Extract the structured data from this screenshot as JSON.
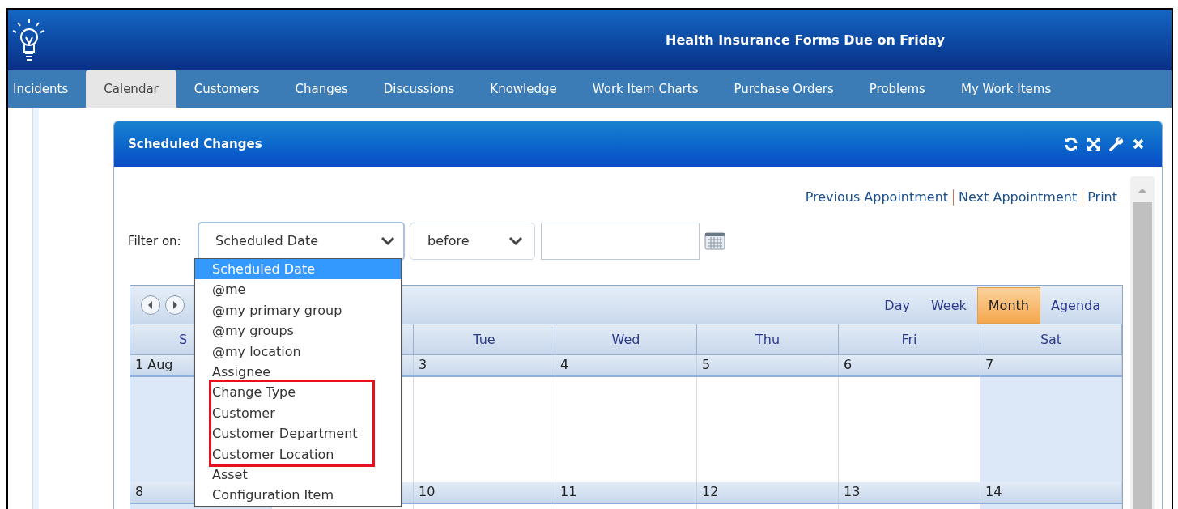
{
  "header": {
    "title": "Health Insurance Forms Due on Friday"
  },
  "tabs": [
    {
      "label": "Incidents",
      "selected": false
    },
    {
      "label": "Calendar",
      "selected": true
    },
    {
      "label": "Customers",
      "selected": false
    },
    {
      "label": "Changes",
      "selected": false
    },
    {
      "label": "Discussions",
      "selected": false
    },
    {
      "label": "Knowledge",
      "selected": false
    },
    {
      "label": "Work Item Charts",
      "selected": false
    },
    {
      "label": "Purchase Orders",
      "selected": false
    },
    {
      "label": "Problems",
      "selected": false
    },
    {
      "label": "My Work Items",
      "selected": false
    }
  ],
  "panel": {
    "title": "Scheduled Changes",
    "links": [
      "Previous Appointment",
      "Next Appointment",
      "Print"
    ],
    "filter": {
      "label": "Filter on:",
      "field": "Scheduled Date",
      "operator": "before",
      "expanded": true,
      "options": [
        {
          "label": "Scheduled Date",
          "selected": true,
          "flagged": false
        },
        {
          "label": "@me",
          "selected": false,
          "flagged": false
        },
        {
          "label": "@my primary group",
          "selected": false,
          "flagged": false
        },
        {
          "label": "@my groups",
          "selected": false,
          "flagged": false
        },
        {
          "label": "@my location",
          "selected": false,
          "flagged": false
        },
        {
          "label": "Assignee",
          "selected": false,
          "flagged": false
        },
        {
          "label": "Change Type",
          "selected": false,
          "flagged": true
        },
        {
          "label": "Customer",
          "selected": false,
          "flagged": true
        },
        {
          "label": "Customer Department",
          "selected": false,
          "flagged": true
        },
        {
          "label": "Customer Location",
          "selected": false,
          "flagged": true
        },
        {
          "label": "Asset",
          "selected": false,
          "flagged": false
        },
        {
          "label": "Configuration Item",
          "selected": false,
          "flagged": false
        }
      ]
    },
    "calendar": {
      "views": [
        {
          "label": "Day",
          "selected": false
        },
        {
          "label": "Week",
          "selected": false
        },
        {
          "label": "Month",
          "selected": true
        },
        {
          "label": "Agenda",
          "selected": false
        }
      ],
      "days": [
        {
          "label": "S",
          "weekend": true
        },
        {
          "weekend": false
        },
        {
          "label": "Tue",
          "weekend": false
        },
        {
          "label": "Wed",
          "weekend": false
        },
        {
          "label": "Thu",
          "weekend": false
        },
        {
          "label": "Fri",
          "weekend": false
        },
        {
          "label": "Sat",
          "weekend": true
        }
      ],
      "weeks": [
        {
          "dates": [
            "1 Aug",
            "3",
            "4",
            "5",
            "6",
            "7"
          ]
        },
        {
          "dates": [
            "8",
            "10",
            "11",
            "12",
            "13",
            "14"
          ]
        }
      ]
    }
  }
}
